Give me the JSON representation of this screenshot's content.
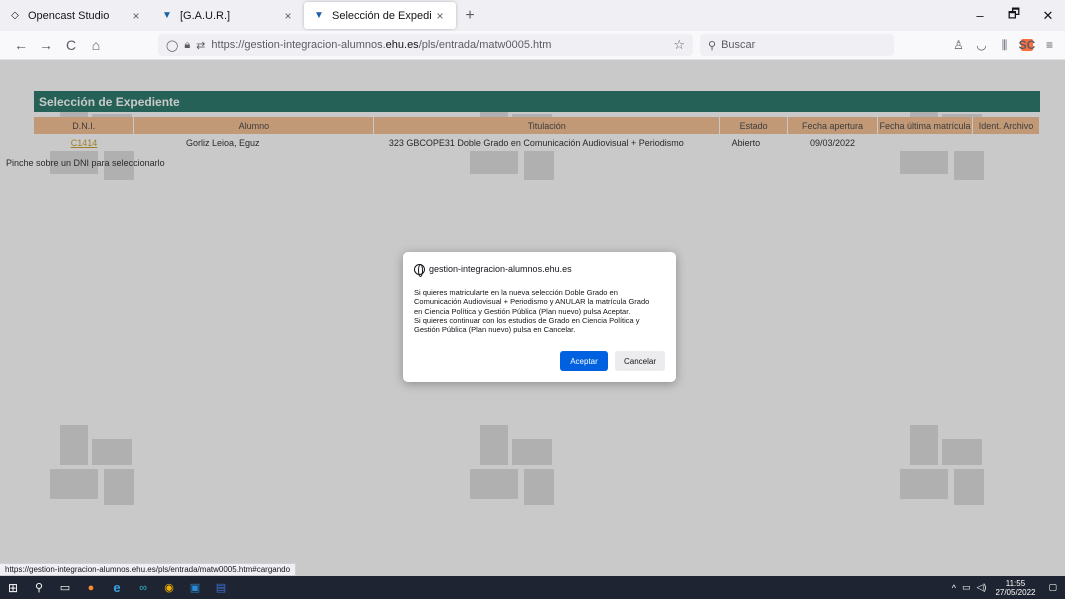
{
  "tabs": [
    {
      "title": "Opencast Studio",
      "icon": "opencast-icon",
      "active": false
    },
    {
      "title": "[G.A.U.R.]",
      "icon": "ehu-icon",
      "active": false
    },
    {
      "title": "Selección de Expediente",
      "icon": "ehu-icon",
      "active": true
    }
  ],
  "tab_close_glyph": "×",
  "new_tab_glyph": "+",
  "window_controls": {
    "minimize": "–",
    "restore": "🗗",
    "close": "✕"
  },
  "nav": {
    "back": "←",
    "forward": "→",
    "reload": "C",
    "home": "⌂"
  },
  "url": {
    "prefix": "https://gestion-integracion-alumnos.",
    "domain": "ehu.es",
    "suffix": "/pls/entrada/matw0005.htm"
  },
  "search": {
    "placeholder": "Buscar"
  },
  "toolbar_badge": "SC",
  "page": {
    "header": "Selección de Expediente",
    "columns": [
      "D.N.I.",
      "Alumno",
      "Titulación",
      "Estado",
      "Fecha apertura",
      "Fecha última matrícula",
      "Ident. Archivo"
    ],
    "rows": [
      {
        "dni": "C1414",
        "alumno": "Gorliz Leioa, Eguz",
        "titulacion": "323  GBCOPE31  Doble Grado en Comunicación Audiovisual + Periodismo",
        "estado": "Abierto",
        "apertura": "09/03/2022",
        "ultima": "",
        "archivo": ""
      }
    ],
    "hint": "Pinche sobre un DNI para seleccionarlo"
  },
  "dialog": {
    "origin": "gestion-integracion-alumnos.ehu.es",
    "message": "Si quieres matricularte en la nueva selección Doble Grado en\nComunicación Audiovisual + Periodismo y ANULAR la matrícula Grado\nen Ciencia Política y Gestión Pública (Plan nuevo) pulsa Aceptar.\nSi quieres continuar con los estudios de Grado en Ciencia Política y\nGestión Pública (Plan nuevo) pulsa en Cancelar.",
    "accept": "Aceptar",
    "cancel": "Cancelar"
  },
  "status_url": "https://gestion-integracion-alumnos.ehu.es/pls/entrada/matw0005.htm#cargando",
  "taskbar": {
    "time": "11:55",
    "date": "27/05/2022"
  },
  "colors": {
    "header": "#1c7062",
    "table_header": "#f5bd8e",
    "accept": "#0061e0"
  }
}
